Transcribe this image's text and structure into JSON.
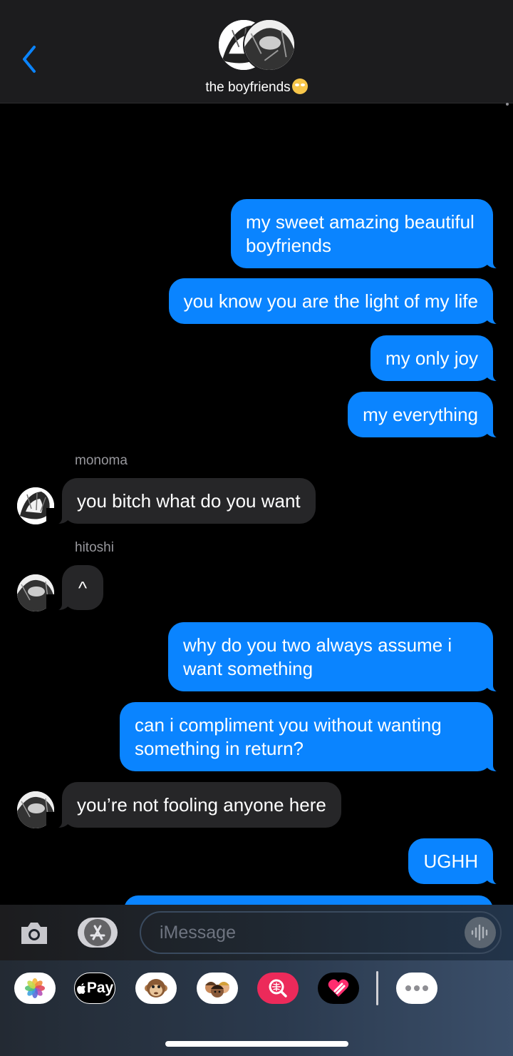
{
  "header": {
    "title": "the boyfriends",
    "title_emoji": "eye-roll-emoji",
    "back_icon": "chevron-left-icon"
  },
  "messages": [
    {
      "direction": "out",
      "text": "my sweet amazing beautiful boyfriends"
    },
    {
      "direction": "out",
      "text": "you know you are the light of my life"
    },
    {
      "direction": "out",
      "text": "my only joy"
    },
    {
      "direction": "out",
      "text": "my everything"
    },
    {
      "direction": "in",
      "sender": "monoma",
      "text": "you bitch what do you want"
    },
    {
      "direction": "in",
      "sender": "hitoshi",
      "text": "^"
    },
    {
      "direction": "out",
      "text": "why do you two always assume i want something"
    },
    {
      "direction": "out",
      "text": "can i compliment you without wanting something in return?"
    },
    {
      "direction": "in",
      "text": "you’re not fooling anyone here"
    },
    {
      "direction": "out",
      "text": "UGHH"
    }
  ],
  "composer": {
    "placeholder": "iMessage",
    "camera_icon": "camera-icon",
    "apps_icon": "app-store-icon",
    "audio_icon": "audio-waveform-icon"
  },
  "app_drawer": {
    "apps": [
      "photos-icon",
      "apple-pay-icon",
      "animoji-icon",
      "memoji-icon",
      "image-search-icon",
      "digital-touch-icon",
      "more-icon"
    ],
    "apple_pay_label": "Pay"
  },
  "colors": {
    "outgoing_bubble": "#0a84ff",
    "incoming_bubble": "#262628",
    "header_bg": "#1c1c1e",
    "background": "#000000"
  }
}
